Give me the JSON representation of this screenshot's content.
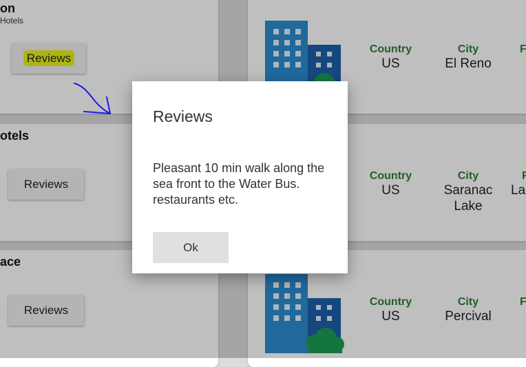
{
  "hotels": [
    {
      "name": "on",
      "subtitle": "Hotels",
      "reviews_label": "Reviews",
      "country_label": "Country",
      "country": "US",
      "city_label": "City",
      "city": "El Reno",
      "extra_label": "F",
      "extra_value": ""
    },
    {
      "name": "otels",
      "subtitle": "",
      "reviews_label": "Reviews",
      "country_label": "Country",
      "country": "US",
      "city_label": "City",
      "city": "Saranac Lake",
      "extra_label": "F",
      "extra_value": "La"
    },
    {
      "name": "ace",
      "subtitle": "",
      "reviews_label": "Reviews",
      "country_label": "Country",
      "country": "US",
      "city_label": "City",
      "city": "Percival",
      "extra_label": "F",
      "extra_value": ""
    }
  ],
  "dialog": {
    "title": "Reviews",
    "message": "Pleasant 10 min walk along the sea front to the Water Bus. restaurants etc.",
    "ok_label": "Ok"
  },
  "annotations": {
    "highlight_color": "#e8f016",
    "arrow_color": "#1a1ae6"
  },
  "colors": {
    "field_label": "#2e7d32",
    "building_light": "#2b8cd0",
    "building_dark": "#1e5fa8",
    "tree": "#1b9e55"
  }
}
